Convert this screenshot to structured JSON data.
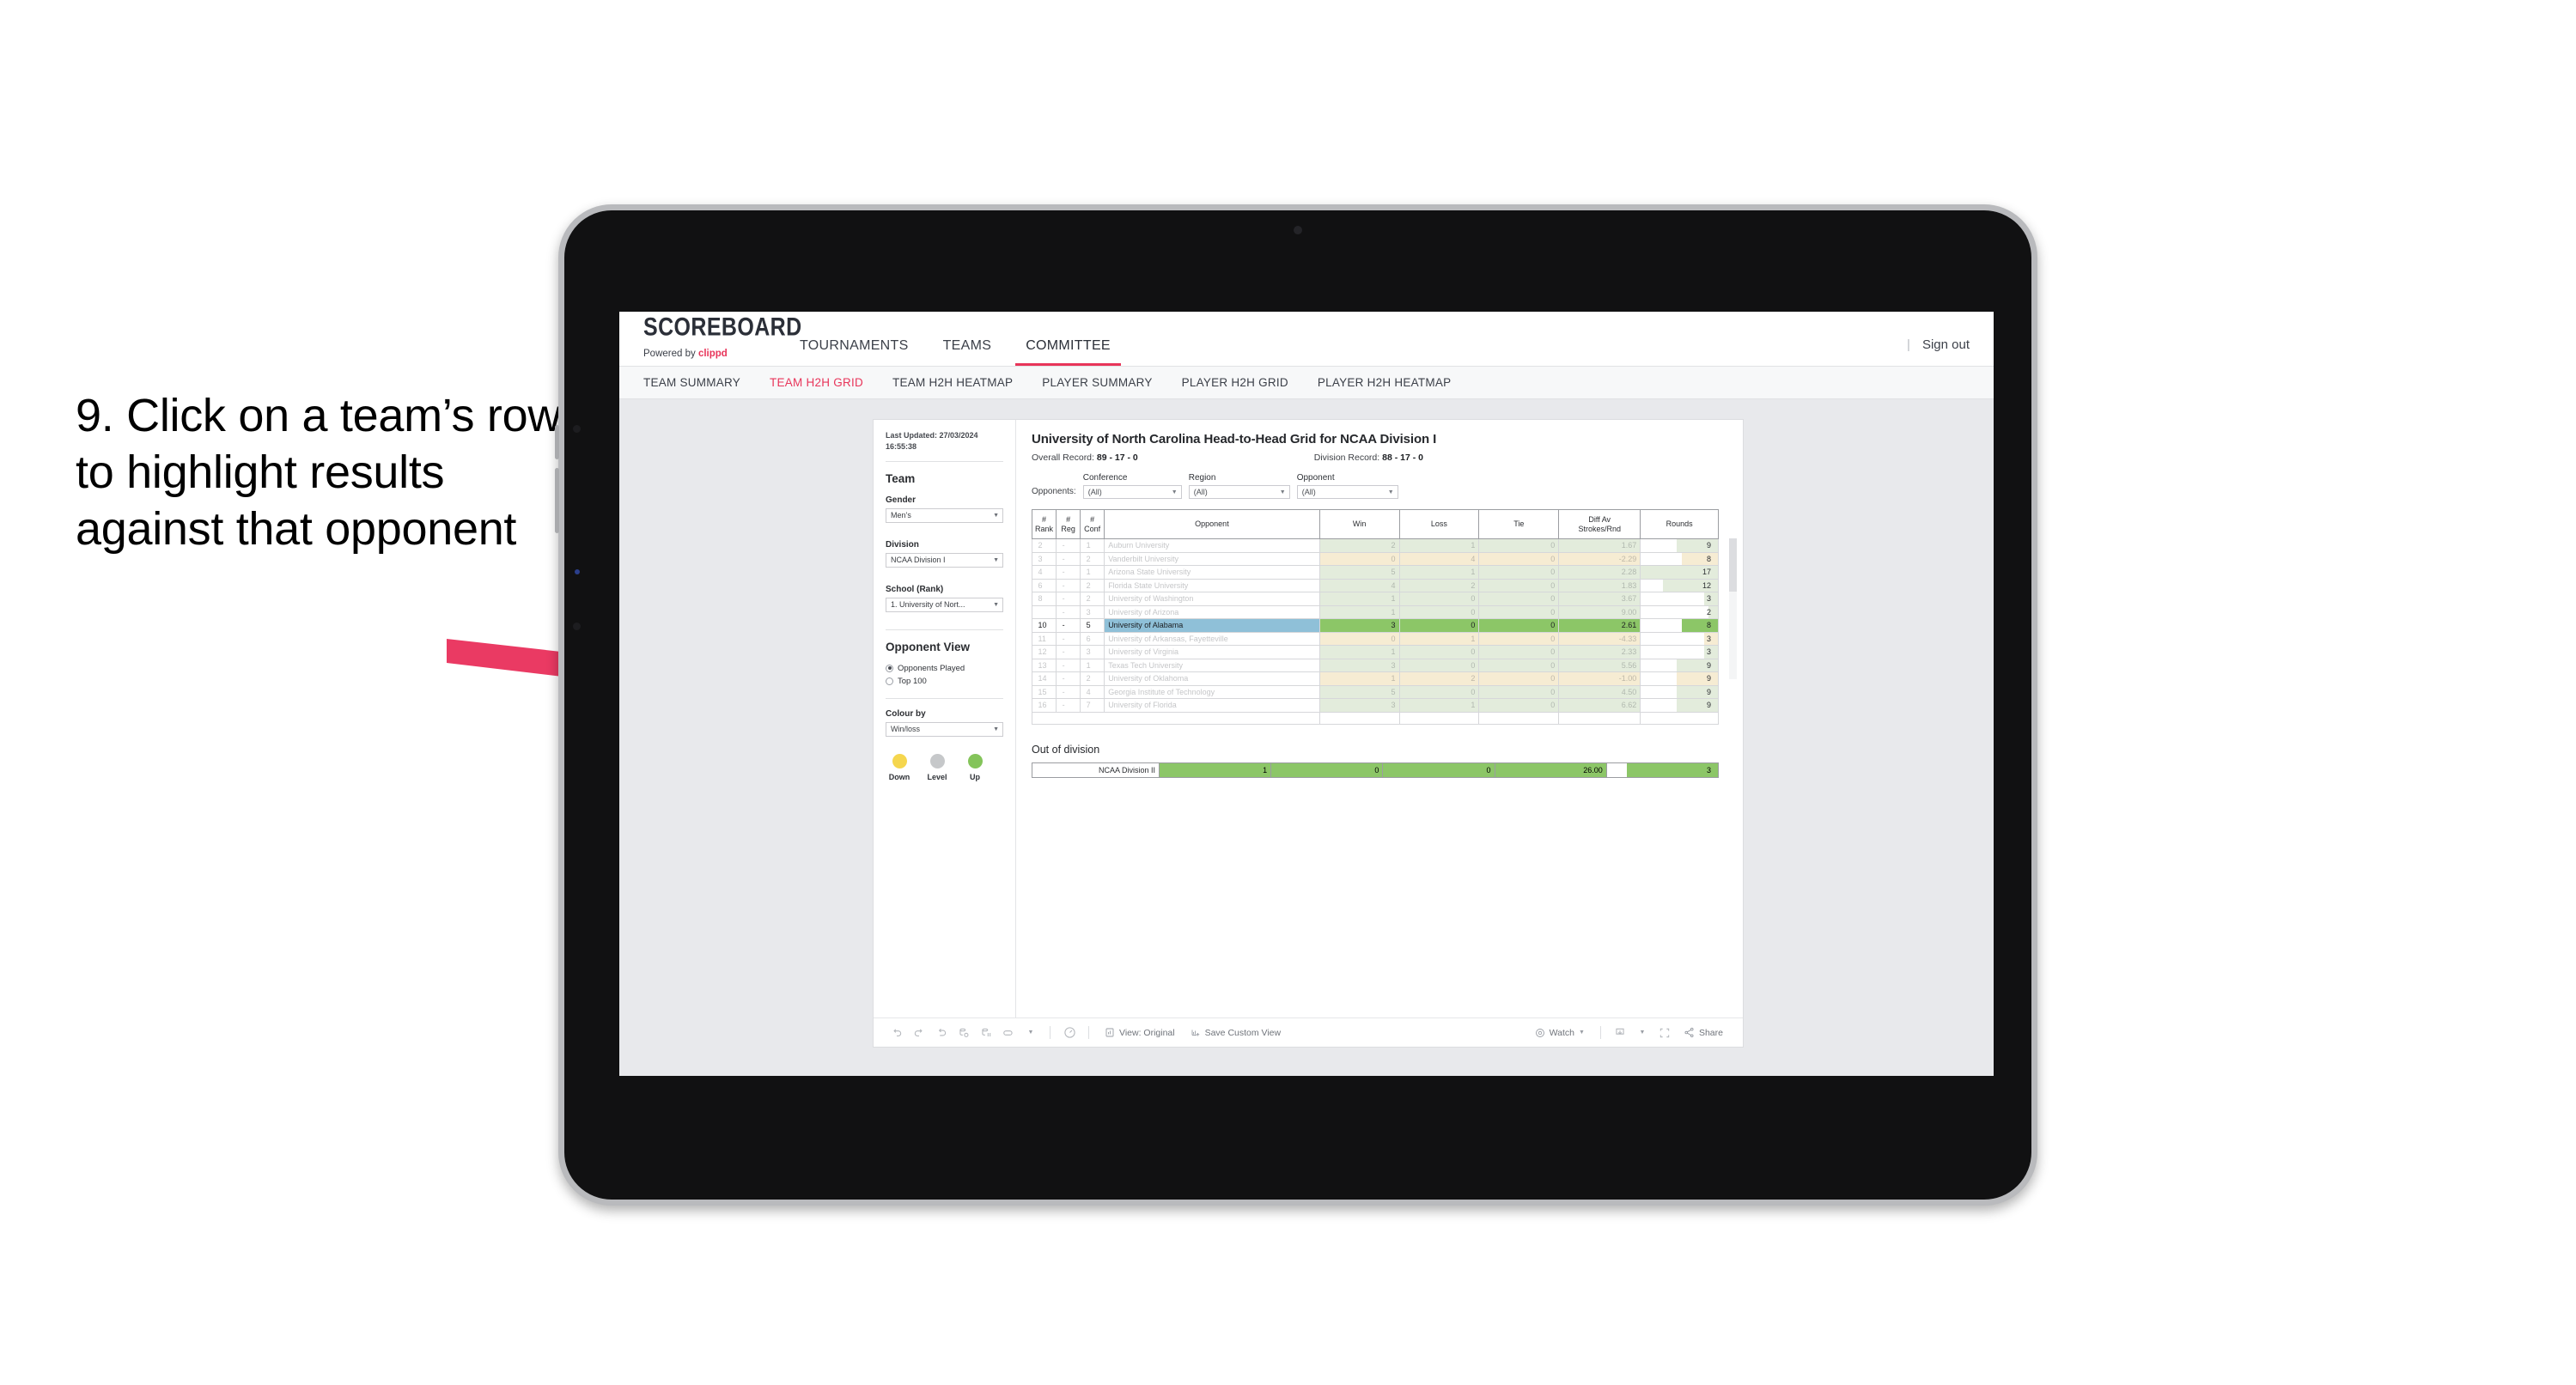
{
  "annotation": {
    "text": "9. Click on a team’s row to highlight results against that opponent",
    "arrow_color": "#ea3a63"
  },
  "header": {
    "brand_title": "SCOREBOARD",
    "brand_powered_prefix": "Powered by ",
    "brand_powered_name": "clippd",
    "nav": [
      {
        "label": "TOURNAMENTS",
        "active": false
      },
      {
        "label": "TEAMS",
        "active": false
      },
      {
        "label": "COMMITTEE",
        "active": true
      }
    ],
    "separator": "|",
    "sign_out": "Sign out",
    "accent_color": "#e8355a"
  },
  "subnav": [
    {
      "label": "TEAM SUMMARY",
      "active": false
    },
    {
      "label": "TEAM H2H GRID",
      "active": true
    },
    {
      "label": "TEAM H2H HEATMAP",
      "active": false
    },
    {
      "label": "PLAYER SUMMARY",
      "active": false
    },
    {
      "label": "PLAYER H2H GRID",
      "active": false
    },
    {
      "label": "PLAYER H2H HEATMAP",
      "active": false
    }
  ],
  "filters": {
    "last_updated_label": "Last Updated: 27/03/2024",
    "last_updated_time": "16:55:38",
    "team_heading": "Team",
    "gender_label": "Gender",
    "gender_value": "Men’s",
    "division_label": "Division",
    "division_value": "NCAA Division I",
    "school_label": "School (Rank)",
    "school_value": "1. University of Nort...",
    "opponent_view_heading": "Opponent View",
    "opponent_view_options": [
      {
        "label": "Opponents Played",
        "selected": true
      },
      {
        "label": "Top 100",
        "selected": false
      }
    ],
    "colour_by_label": "Colour by",
    "colour_by_value": "Win/loss",
    "legend": [
      {
        "caption": "Down",
        "color": "#f5d64e"
      },
      {
        "caption": "Level",
        "color": "#c6c8ca"
      },
      {
        "caption": "Up",
        "color": "#84c45a"
      }
    ]
  },
  "viz": {
    "title": "University of North Carolina Head-to-Head Grid for NCAA Division I",
    "overall_record_label": "Overall Record: ",
    "overall_record_value": "89 - 17 - 0",
    "division_record_label": "Division Record: ",
    "division_record_value": "88 - 17 - 0",
    "opponents_label": "Opponents:",
    "opponent_filters": [
      {
        "label": "Conference",
        "value": "(All)"
      },
      {
        "label": "Region",
        "value": "(All)"
      },
      {
        "label": "Opponent",
        "value": "(All)"
      }
    ]
  },
  "chart_data": {
    "type": "table",
    "title": "University of North Carolina Head-to-Head Grid for NCAA Division I",
    "columns": [
      "# Rank",
      "# Reg",
      "# Conf",
      "Opponent",
      "Win",
      "Loss",
      "Tie",
      "Diff Av Strokes/Rnd",
      "Rounds"
    ],
    "column_header_lines": [
      [
        "#",
        "Rank"
      ],
      [
        "#",
        "Reg"
      ],
      [
        "#",
        "Conf"
      ],
      [
        "Opponent"
      ],
      [
        "Win"
      ],
      [
        "Loss"
      ],
      [
        "Tie"
      ],
      [
        "Diff Av",
        "Strokes/Rnd"
      ],
      [
        "Rounds"
      ]
    ],
    "rows": [
      {
        "rank": "2",
        "reg": "-",
        "conf": "1",
        "opponent": "Auburn University",
        "win": "2",
        "loss": "1",
        "tie": "0",
        "diff": "1.67",
        "rounds": "9",
        "tone": "up",
        "selected": false
      },
      {
        "rank": "3",
        "reg": "-",
        "conf": "2",
        "opponent": "Vanderbilt University",
        "win": "0",
        "loss": "4",
        "tie": "0",
        "diff": "-2.29",
        "rounds": "8",
        "tone": "down",
        "selected": false
      },
      {
        "rank": "4",
        "reg": "-",
        "conf": "1",
        "opponent": "Arizona State University",
        "win": "5",
        "loss": "1",
        "tie": "0",
        "diff": "2.28",
        "rounds": "17",
        "tone": "up",
        "selected": false
      },
      {
        "rank": "6",
        "reg": "-",
        "conf": "2",
        "opponent": "Florida State University",
        "win": "4",
        "loss": "2",
        "tie": "0",
        "diff": "1.83",
        "rounds": "12",
        "tone": "up",
        "selected": false
      },
      {
        "rank": "8",
        "reg": "-",
        "conf": "2",
        "opponent": "University of Washington",
        "win": "1",
        "loss": "0",
        "tie": "0",
        "diff": "3.67",
        "rounds": "3",
        "tone": "up",
        "selected": false
      },
      {
        "rank": "",
        "reg": "-",
        "conf": "3",
        "opponent": "University of Arizona",
        "win": "1",
        "loss": "0",
        "tie": "0",
        "diff": "9.00",
        "rounds": "2",
        "tone": "up",
        "selected": false
      },
      {
        "rank": "10",
        "reg": "-",
        "conf": "5",
        "opponent": "University of Alabama",
        "win": "3",
        "loss": "0",
        "tie": "0",
        "diff": "2.61",
        "rounds": "8",
        "tone": "up",
        "selected": true
      },
      {
        "rank": "11",
        "reg": "-",
        "conf": "6",
        "opponent": "University of Arkansas, Fayetteville",
        "win": "0",
        "loss": "1",
        "tie": "0",
        "diff": "-4.33",
        "rounds": "3",
        "tone": "down",
        "selected": false
      },
      {
        "rank": "12",
        "reg": "-",
        "conf": "3",
        "opponent": "University of Virginia",
        "win": "1",
        "loss": "0",
        "tie": "0",
        "diff": "2.33",
        "rounds": "3",
        "tone": "up",
        "selected": false
      },
      {
        "rank": "13",
        "reg": "-",
        "conf": "1",
        "opponent": "Texas Tech University",
        "win": "3",
        "loss": "0",
        "tie": "0",
        "diff": "5.56",
        "rounds": "9",
        "tone": "up",
        "selected": false
      },
      {
        "rank": "14",
        "reg": "-",
        "conf": "2",
        "opponent": "University of Oklahoma",
        "win": "1",
        "loss": "2",
        "tie": "0",
        "diff": "-1.00",
        "rounds": "9",
        "tone": "down",
        "selected": false
      },
      {
        "rank": "15",
        "reg": "-",
        "conf": "4",
        "opponent": "Georgia Institute of Technology",
        "win": "5",
        "loss": "0",
        "tie": "0",
        "diff": "4.50",
        "rounds": "9",
        "tone": "up",
        "selected": false
      },
      {
        "rank": "16",
        "reg": "-",
        "conf": "7",
        "opponent": "University of Florida",
        "win": "3",
        "loss": "1",
        "tie": "0",
        "diff": "6.62",
        "rounds": "9",
        "tone": "up",
        "selected": false
      }
    ],
    "out_of_division": {
      "title": "Out of division",
      "rows": [
        {
          "name": "NCAA Division II",
          "win": "1",
          "loss": "0",
          "tie": "0",
          "diff": "26.00",
          "rounds": "3",
          "tone": "up"
        }
      ]
    },
    "colors": {
      "up_fill": "#e3ecdc",
      "down_fill": "#f6ecd3",
      "selected_row": "#8fc0d8",
      "selected_fill": "#8cc667",
      "out_of_division_fill": "#8cc667",
      "rounds_bar": "#e3ecdc"
    }
  },
  "toolbar": {
    "icons": [
      "undo-icon",
      "redo-icon",
      "revert-icon",
      "refresh-icon",
      "pause-icon",
      "alerts-icon",
      "reset-icon"
    ],
    "view_original": "View: Original",
    "save_custom_view": "Save Custom View",
    "watch": "Watch",
    "download": "download-icon",
    "fullscreen": "fullscreen-icon",
    "share": "Share"
  }
}
